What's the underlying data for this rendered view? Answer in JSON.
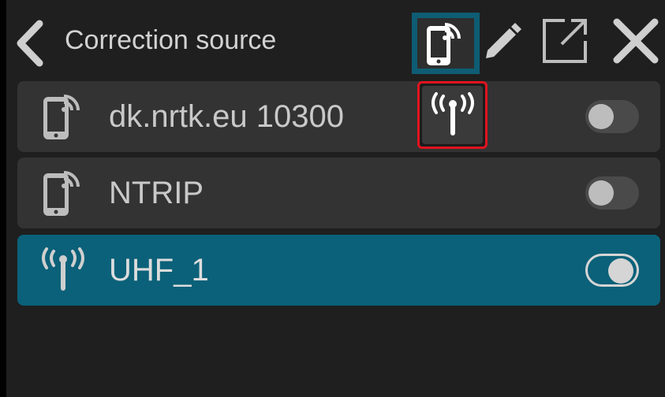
{
  "header": {
    "title": "Correction source",
    "back_icon": "chevron-left-icon",
    "active_type_icon": "phone-wifi-icon",
    "edit_icon": "pencil-icon",
    "export_icon": "external-link-icon",
    "close_icon": "close-icon"
  },
  "sources": [
    {
      "label": "dk.nrtk.eu 10300",
      "icon": "phone-wifi-icon",
      "enabled": false
    },
    {
      "label": "NTRIP",
      "icon": "phone-wifi-icon",
      "enabled": false
    },
    {
      "label": "UHF_1",
      "icon": "radio-antenna-icon",
      "enabled": true
    }
  ],
  "highlighted_icon": "radio-antenna-icon",
  "colors": {
    "background": "#1f1f1f",
    "row": "#333333",
    "row_selected": "#0b6179",
    "text": "#c9c9c9",
    "highlight_border": "#e0141e"
  }
}
